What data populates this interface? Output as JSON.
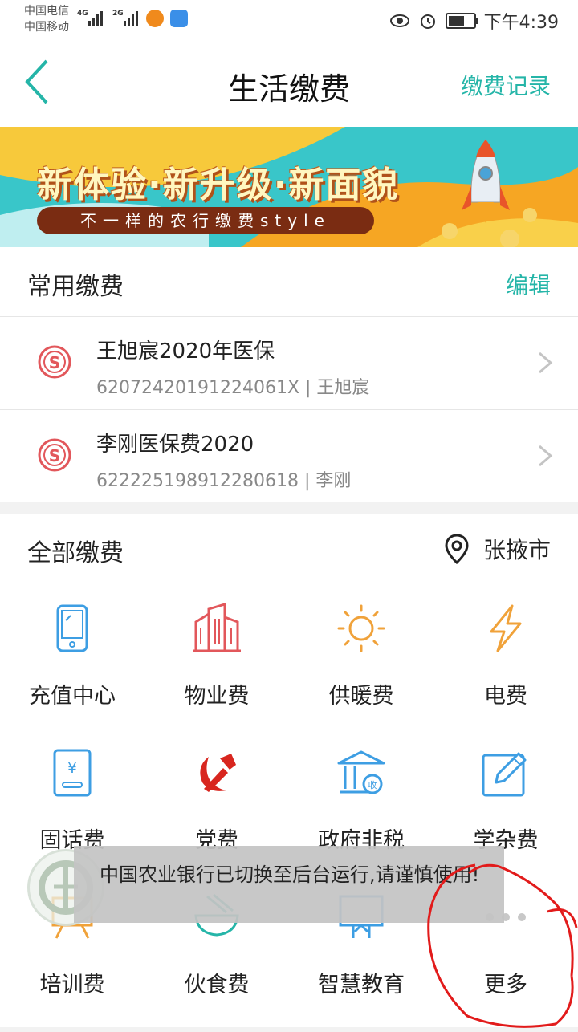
{
  "status_bar": {
    "carrier_1": "中国电信",
    "carrier_2": "中国移动",
    "net_1": "4G",
    "net_2": "2G",
    "time": "下午4:39"
  },
  "header": {
    "title": "生活缴费",
    "record_link": "缴费记录"
  },
  "banner": {
    "headline": "新体验·新升级·新面貌",
    "tagline": "不一样的农行缴费style"
  },
  "frequent": {
    "title": "常用缴费",
    "edit_label": "编辑",
    "items": [
      {
        "name": "王旭宸2020年医保",
        "detail": "62072420191224061X | 王旭宸",
        "icon": "social-insurance-icon"
      },
      {
        "name": "李刚医保费2020",
        "detail": "622225198912280618 | 李刚",
        "icon": "social-insurance-icon"
      }
    ]
  },
  "all": {
    "title": "全部缴费",
    "city": "张掖市",
    "services": [
      {
        "label": "充值中心",
        "icon": "phone-icon"
      },
      {
        "label": "物业费",
        "icon": "building-icon"
      },
      {
        "label": "供暖费",
        "icon": "sun-icon"
      },
      {
        "label": "电费",
        "icon": "lightning-icon"
      },
      {
        "label": "固话费",
        "icon": "landline-icon"
      },
      {
        "label": "党费",
        "icon": "party-icon"
      },
      {
        "label": "政府非税",
        "icon": "government-icon"
      },
      {
        "label": "学杂费",
        "icon": "edit-icon"
      },
      {
        "label": "培训费",
        "icon": "training-icon"
      },
      {
        "label": "伙食费",
        "icon": "bowl-icon"
      },
      {
        "label": "智慧教育",
        "icon": "education-icon"
      },
      {
        "label": "更多",
        "icon": "more-icon"
      }
    ]
  },
  "toast": {
    "message": "中国农业银行已切换至后台运行,请谨慎使用!"
  },
  "colors": {
    "accent": "#25b5a8",
    "icon_blue": "#3d9ee3",
    "icon_red": "#e2575b",
    "icon_orange": "#f0a23a",
    "party_red": "#d8261f"
  }
}
